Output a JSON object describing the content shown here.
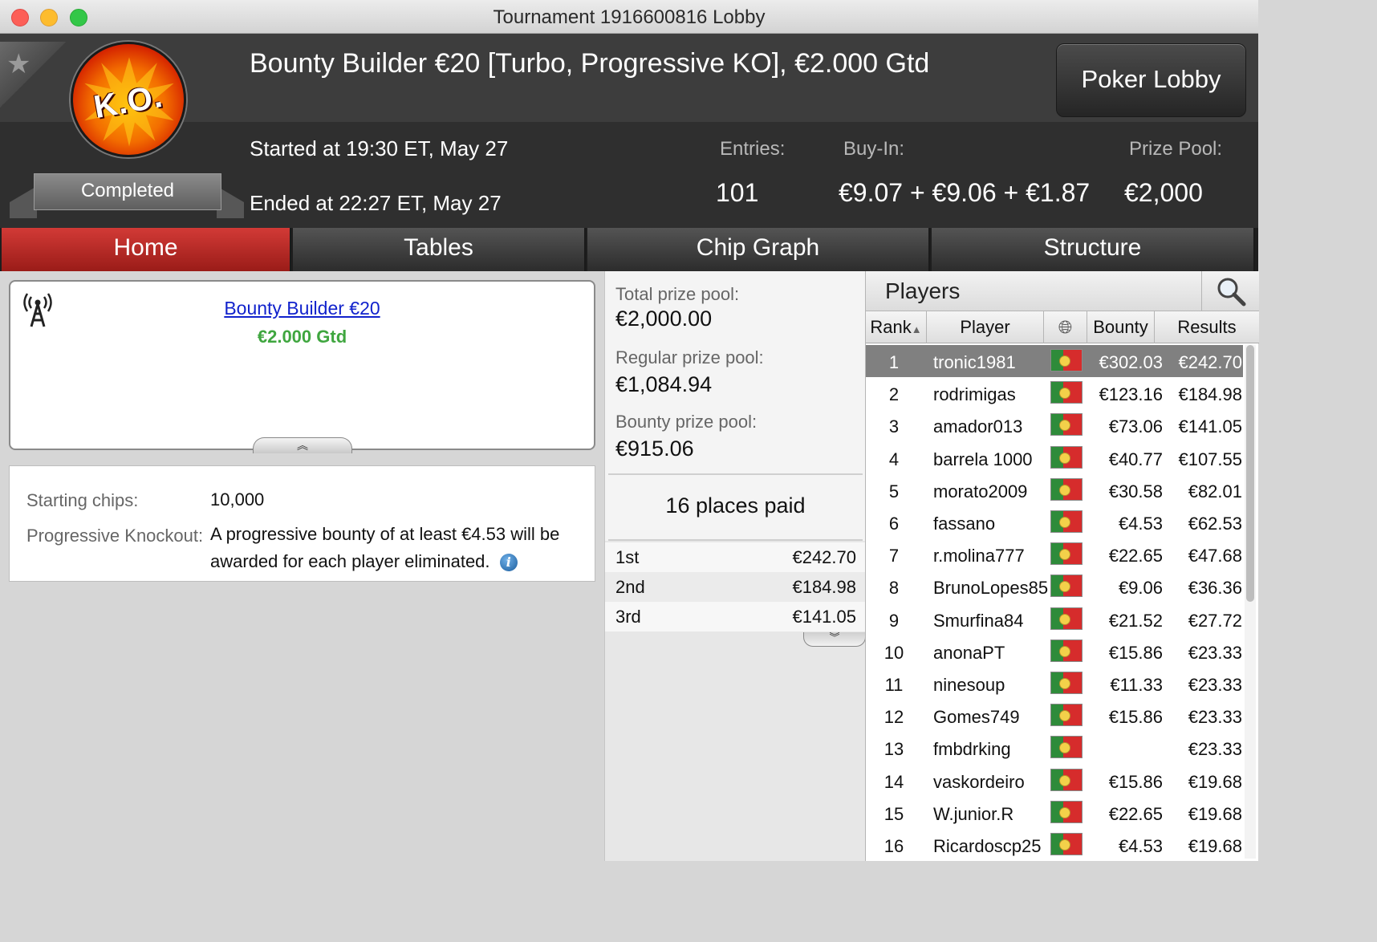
{
  "window": {
    "title": "Tournament 1916600816 Lobby"
  },
  "header": {
    "tournament_name": "Bounty Builder €20 [Turbo, Progressive KO], €2.000 Gtd",
    "logo_text": "K.O.",
    "status": "Completed",
    "started": "Started at 19:30 ET, May 27",
    "ended": "Ended at 22:27 ET, May 27",
    "poker_lobby_label": "Poker Lobby",
    "entries_label": "Entries:",
    "entries_value": "101",
    "buyin_label": "Buy-In:",
    "buyin_value": "€9.07 + €9.06 + €1.87",
    "prizepool_label": "Prize Pool:",
    "prizepool_value": "€2,000"
  },
  "tabs": [
    {
      "label": "Home",
      "active": true
    },
    {
      "label": "Tables",
      "active": false
    },
    {
      "label": "Chip Graph",
      "active": false
    },
    {
      "label": "Structure",
      "active": false
    }
  ],
  "info_card": {
    "link": "Bounty Builder €20",
    "gtd": "€2.000 Gtd"
  },
  "details": {
    "starting_chips_label": "Starting chips:",
    "starting_chips_value": "10,000",
    "progressive_label": "Progressive Knockout:",
    "progressive_line1": "A progressive bounty of at least €4.53 will be",
    "progressive_line2": "awarded for each player eliminated."
  },
  "prize": {
    "total_label": "Total prize pool:",
    "total_value": "€2,000.00",
    "regular_label": "Regular prize pool:",
    "regular_value": "€1,084.94",
    "bounty_label": "Bounty prize pool:",
    "bounty_value": "€915.06",
    "places_paid": "16 places paid",
    "payouts": [
      {
        "place": "1st",
        "amount": "€242.70"
      },
      {
        "place": "2nd",
        "amount": "€184.98"
      },
      {
        "place": "3rd",
        "amount": "€141.05"
      }
    ]
  },
  "players": {
    "title": "Players",
    "columns": {
      "rank": "Rank",
      "player": "Player",
      "bounty": "Bounty",
      "results": "Results"
    },
    "rows": [
      {
        "rank": "1",
        "name": "tronic1981",
        "bounty": "€302.03",
        "result": "€242.70"
      },
      {
        "rank": "2",
        "name": "rodrimigas",
        "bounty": "€123.16",
        "result": "€184.98"
      },
      {
        "rank": "3",
        "name": "amador013",
        "bounty": "€73.06",
        "result": "€141.05"
      },
      {
        "rank": "4",
        "name": "barrela 1000",
        "bounty": "€40.77",
        "result": "€107.55"
      },
      {
        "rank": "5",
        "name": "morato2009",
        "bounty": "€30.58",
        "result": "€82.01"
      },
      {
        "rank": "6",
        "name": "fassano",
        "bounty": "€4.53",
        "result": "€62.53"
      },
      {
        "rank": "7",
        "name": "r.molina777",
        "bounty": "€22.65",
        "result": "€47.68"
      },
      {
        "rank": "8",
        "name": "BrunoLopes85",
        "bounty": "€9.06",
        "result": "€36.36"
      },
      {
        "rank": "9",
        "name": "Smurfina84",
        "bounty": "€21.52",
        "result": "€27.72"
      },
      {
        "rank": "10",
        "name": "anonaPT",
        "bounty": "€15.86",
        "result": "€23.33"
      },
      {
        "rank": "11",
        "name": "ninesoup",
        "bounty": "€11.33",
        "result": "€23.33"
      },
      {
        "rank": "12",
        "name": "Gomes749",
        "bounty": "€15.86",
        "result": "€23.33"
      },
      {
        "rank": "13",
        "name": "fmbdrking",
        "bounty": "",
        "result": "€23.33"
      },
      {
        "rank": "14",
        "name": "vaskordeiro",
        "bounty": "€15.86",
        "result": "€19.68"
      },
      {
        "rank": "15",
        "name": "W.junior.R",
        "bounty": "€22.65",
        "result": "€19.68"
      },
      {
        "rank": "16",
        "name": "Ricardoscp25",
        "bounty": "€4.53",
        "result": "€19.68"
      }
    ]
  }
}
